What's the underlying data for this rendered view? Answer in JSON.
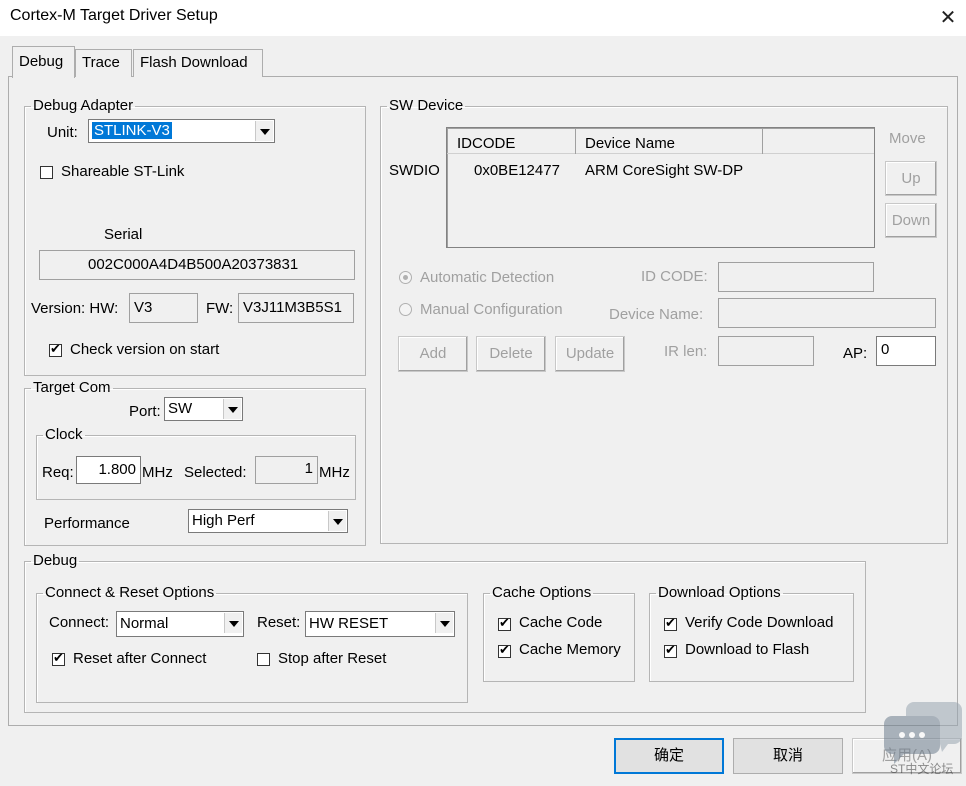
{
  "window": {
    "title": "Cortex-M Target Driver Setup",
    "close_glyph": "✕"
  },
  "tabs": [
    {
      "label": "Debug"
    },
    {
      "label": "Trace"
    },
    {
      "label": "Flash Download"
    }
  ],
  "debug_adapter": {
    "legend": "Debug Adapter",
    "unit_label": "Unit:",
    "unit_value": "STLINK-V3",
    "shareable_label": "Shareable ST-Link",
    "shareable_checked": false,
    "serial_label": "Serial",
    "serial_value": "002C000A4D4B500A20373831",
    "version_label": "Version: HW:",
    "hw_value": "V3",
    "fw_label": "FW:",
    "fw_value": "V3J11M3B5S1",
    "check_version_label": "Check version on start",
    "check_version_checked": true
  },
  "target_com": {
    "legend": "Target Com",
    "port_label": "Port:",
    "port_value": "SW",
    "clock_legend": "Clock",
    "req_label": "Req:",
    "req_value": "1.800",
    "req_unit": "MHz",
    "selected_label": "Selected:",
    "selected_value": "1",
    "selected_unit": "MHz",
    "performance_label": "Performance",
    "performance_value": "High Perf"
  },
  "sw_device": {
    "legend": "SW Device",
    "swdio_label": "SWDIO",
    "columns": [
      "IDCODE",
      "Device Name"
    ],
    "rows": [
      {
        "idcode": "0x0BE12477",
        "device_name": "ARM CoreSight SW-DP"
      }
    ],
    "move_label": "Move",
    "up_label": "Up",
    "down_label": "Down",
    "auto_detect_label": "Automatic Detection",
    "manual_config_label": "Manual Configuration",
    "id_code_label": "ID CODE:",
    "device_name_label": "Device Name:",
    "add_label": "Add",
    "delete_label": "Delete",
    "update_label": "Update",
    "ir_len_label": "IR len:",
    "ap_label": "AP:",
    "ap_value": "0"
  },
  "debug": {
    "legend": "Debug",
    "connect_reset": {
      "legend": "Connect & Reset Options",
      "connect_label": "Connect:",
      "connect_value": "Normal",
      "reset_label": "Reset:",
      "reset_value": "HW RESET",
      "reset_after_connect_label": "Reset after Connect",
      "reset_after_connect_checked": true,
      "stop_after_reset_label": "Stop after Reset",
      "stop_after_reset_checked": false
    },
    "cache": {
      "legend": "Cache Options",
      "cache_code_label": "Cache Code",
      "cache_memory_label": "Cache Memory"
    },
    "download": {
      "legend": "Download Options",
      "verify_label": "Verify Code Download",
      "download_flash_label": "Download to Flash"
    }
  },
  "footer": {
    "ok_label": "确定",
    "cancel_label": "取消",
    "apply_label": "应用(A)"
  },
  "watermark": {
    "text": "ST中文论坛"
  }
}
